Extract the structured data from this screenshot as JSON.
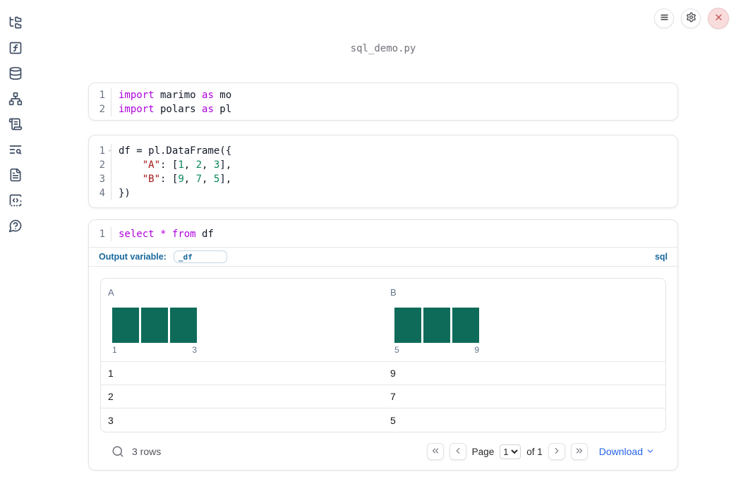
{
  "colors": {
    "histogram_bar": "#0e6b59",
    "keyword": "#af00db",
    "string": "#a31515",
    "number": "#098658",
    "accent_blue": "#19689d",
    "link_blue": "#2563eb",
    "close_red": "#c25454"
  },
  "window": {
    "title": "sql_demo.py"
  },
  "sidebar": {
    "items": [
      {
        "name": "file-explorer",
        "icon": "folder-tree-icon"
      },
      {
        "name": "variables",
        "icon": "function-square-icon"
      },
      {
        "name": "data-sources",
        "icon": "database-icon"
      },
      {
        "name": "dependencies",
        "icon": "network-icon"
      },
      {
        "name": "outline",
        "icon": "scroll-text-icon"
      },
      {
        "name": "logs",
        "icon": "list-search-icon"
      },
      {
        "name": "documentation",
        "icon": "file-text-icon"
      },
      {
        "name": "snippets",
        "icon": "code-square-icon"
      },
      {
        "name": "help",
        "icon": "help-bubble-icon"
      }
    ]
  },
  "cells": [
    {
      "lines": [
        {
          "no": "1",
          "tokens": [
            {
              "t": "kw",
              "v": "import"
            },
            {
              "t": "pl",
              "v": " marimo "
            },
            {
              "t": "kw",
              "v": "as"
            },
            {
              "t": "pl",
              "v": " mo"
            }
          ]
        },
        {
          "no": "2",
          "tokens": [
            {
              "t": "kw",
              "v": "import"
            },
            {
              "t": "pl",
              "v": " polars "
            },
            {
              "t": "kw",
              "v": "as"
            },
            {
              "t": "pl",
              "v": " pl"
            }
          ]
        }
      ]
    },
    {
      "lines": [
        {
          "no": "1",
          "tokens": [
            {
              "t": "pl",
              "v": "df = pl.DataFrame({"
            }
          ]
        },
        {
          "no": "2",
          "tokens": [
            {
              "t": "pl",
              "v": "    "
            },
            {
              "t": "str",
              "v": "\"A\""
            },
            {
              "t": "pl",
              "v": ": ["
            },
            {
              "t": "num",
              "v": "1"
            },
            {
              "t": "pl",
              "v": ", "
            },
            {
              "t": "num",
              "v": "2"
            },
            {
              "t": "pl",
              "v": ", "
            },
            {
              "t": "num",
              "v": "3"
            },
            {
              "t": "pl",
              "v": "],"
            }
          ]
        },
        {
          "no": "3",
          "tokens": [
            {
              "t": "pl",
              "v": "    "
            },
            {
              "t": "str",
              "v": "\"B\""
            },
            {
              "t": "pl",
              "v": ": ["
            },
            {
              "t": "num",
              "v": "9"
            },
            {
              "t": "pl",
              "v": ", "
            },
            {
              "t": "num",
              "v": "7"
            },
            {
              "t": "pl",
              "v": ", "
            },
            {
              "t": "num",
              "v": "5"
            },
            {
              "t": "pl",
              "v": "],"
            }
          ]
        },
        {
          "no": "4",
          "tokens": [
            {
              "t": "pl",
              "v": "})"
            }
          ]
        }
      ]
    },
    {
      "lines": [
        {
          "no": "1",
          "tokens": [
            {
              "t": "kw",
              "v": "select"
            },
            {
              "t": "pl",
              "v": " "
            },
            {
              "t": "kw",
              "v": "*"
            },
            {
              "t": "pl",
              "v": " "
            },
            {
              "t": "kw",
              "v": "from"
            },
            {
              "t": "pl",
              "v": " df"
            }
          ]
        }
      ]
    }
  ],
  "sql_cell": {
    "output_variable_label": "Output variable:",
    "output_variable_value": "_df",
    "language_badge": "sql"
  },
  "table": {
    "columns": [
      {
        "name": "A",
        "histogram": {
          "bars": 3,
          "min_label": "1",
          "max_label": "3"
        }
      },
      {
        "name": "B",
        "histogram": {
          "bars": 3,
          "min_label": "5",
          "max_label": "9"
        }
      }
    ],
    "rows": [
      [
        "1",
        "9"
      ],
      [
        "2",
        "7"
      ],
      [
        "3",
        "5"
      ]
    ],
    "footer": {
      "row_count": "3 rows",
      "page_label": "Page",
      "current_page": "1",
      "of_label": "of 1",
      "download_label": "Download"
    }
  }
}
